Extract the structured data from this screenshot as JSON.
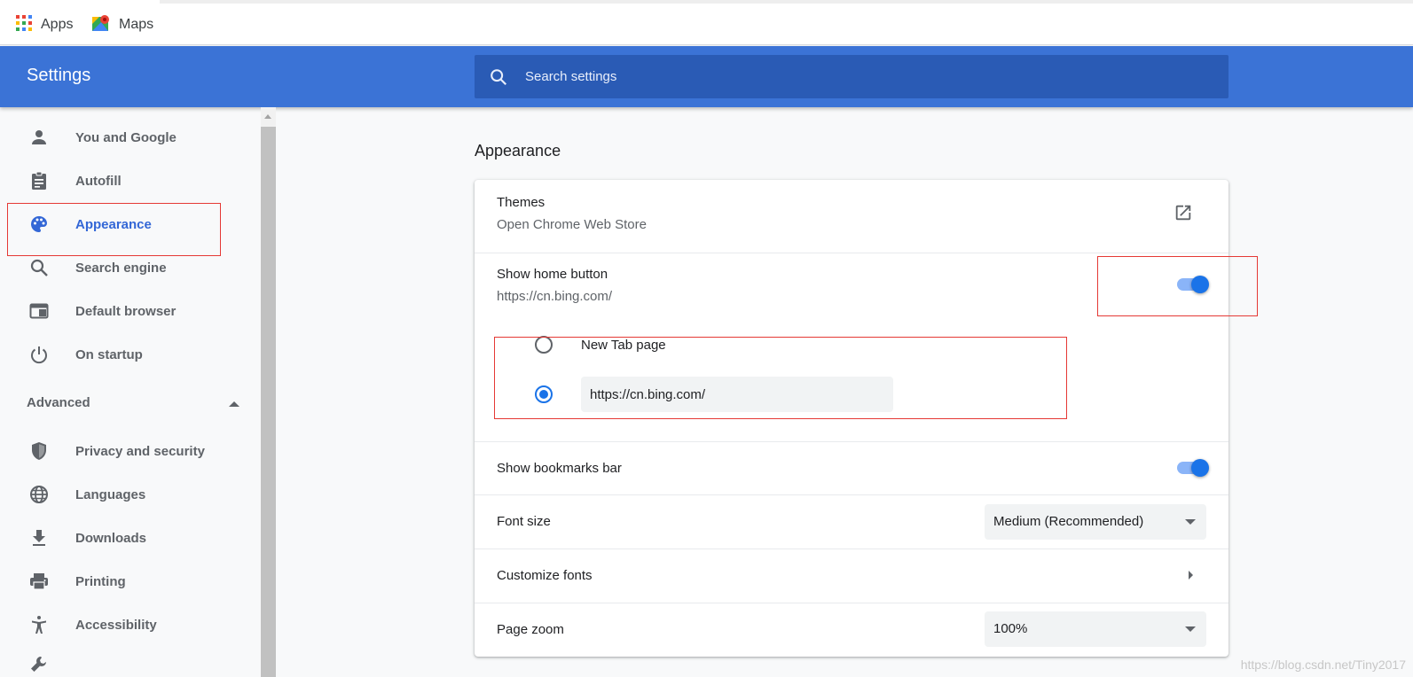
{
  "bookmarks": [
    {
      "label": "Apps",
      "icon": "apps-grid-icon"
    },
    {
      "label": "Maps",
      "icon": "maps-icon"
    }
  ],
  "header": {
    "title": "Settings",
    "search_placeholder": "Search settings"
  },
  "sidebar": {
    "items": [
      {
        "label": "You and Google",
        "icon": "person-icon"
      },
      {
        "label": "Autofill",
        "icon": "clipboard-icon"
      },
      {
        "label": "Appearance",
        "icon": "palette-icon",
        "active": true
      },
      {
        "label": "Search engine",
        "icon": "search-icon"
      },
      {
        "label": "Default browser",
        "icon": "browser-window-icon"
      },
      {
        "label": "On startup",
        "icon": "power-icon"
      }
    ],
    "advanced_label": "Advanced",
    "advanced_items": [
      {
        "label": "Privacy and security",
        "icon": "shield-icon"
      },
      {
        "label": "Languages",
        "icon": "globe-icon"
      },
      {
        "label": "Downloads",
        "icon": "download-icon"
      },
      {
        "label": "Printing",
        "icon": "printer-icon"
      },
      {
        "label": "Accessibility",
        "icon": "accessibility-icon"
      }
    ]
  },
  "appearance": {
    "section_title": "Appearance",
    "themes": {
      "title": "Themes",
      "subtitle": "Open Chrome Web Store"
    },
    "home_button": {
      "title": "Show home button",
      "subtitle": "https://cn.bing.com/",
      "enabled": true
    },
    "home_options": {
      "new_tab_label": "New Tab page",
      "custom_url_value": "https://cn.bing.com/",
      "selected": "custom_url"
    },
    "bookmarks_bar": {
      "title": "Show bookmarks bar",
      "enabled": true
    },
    "font_size": {
      "title": "Font size",
      "value": "Medium (Recommended)"
    },
    "customize_fonts": {
      "title": "Customize fonts"
    },
    "page_zoom": {
      "title": "Page zoom",
      "value": "100%"
    }
  },
  "colors": {
    "header_blue": "#3b73d6",
    "active_blue": "#3367d6",
    "toggle_blue": "#1a73e8",
    "highlight_red": "#e53935"
  },
  "watermark": "https://blog.csdn.net/Tiny2017"
}
